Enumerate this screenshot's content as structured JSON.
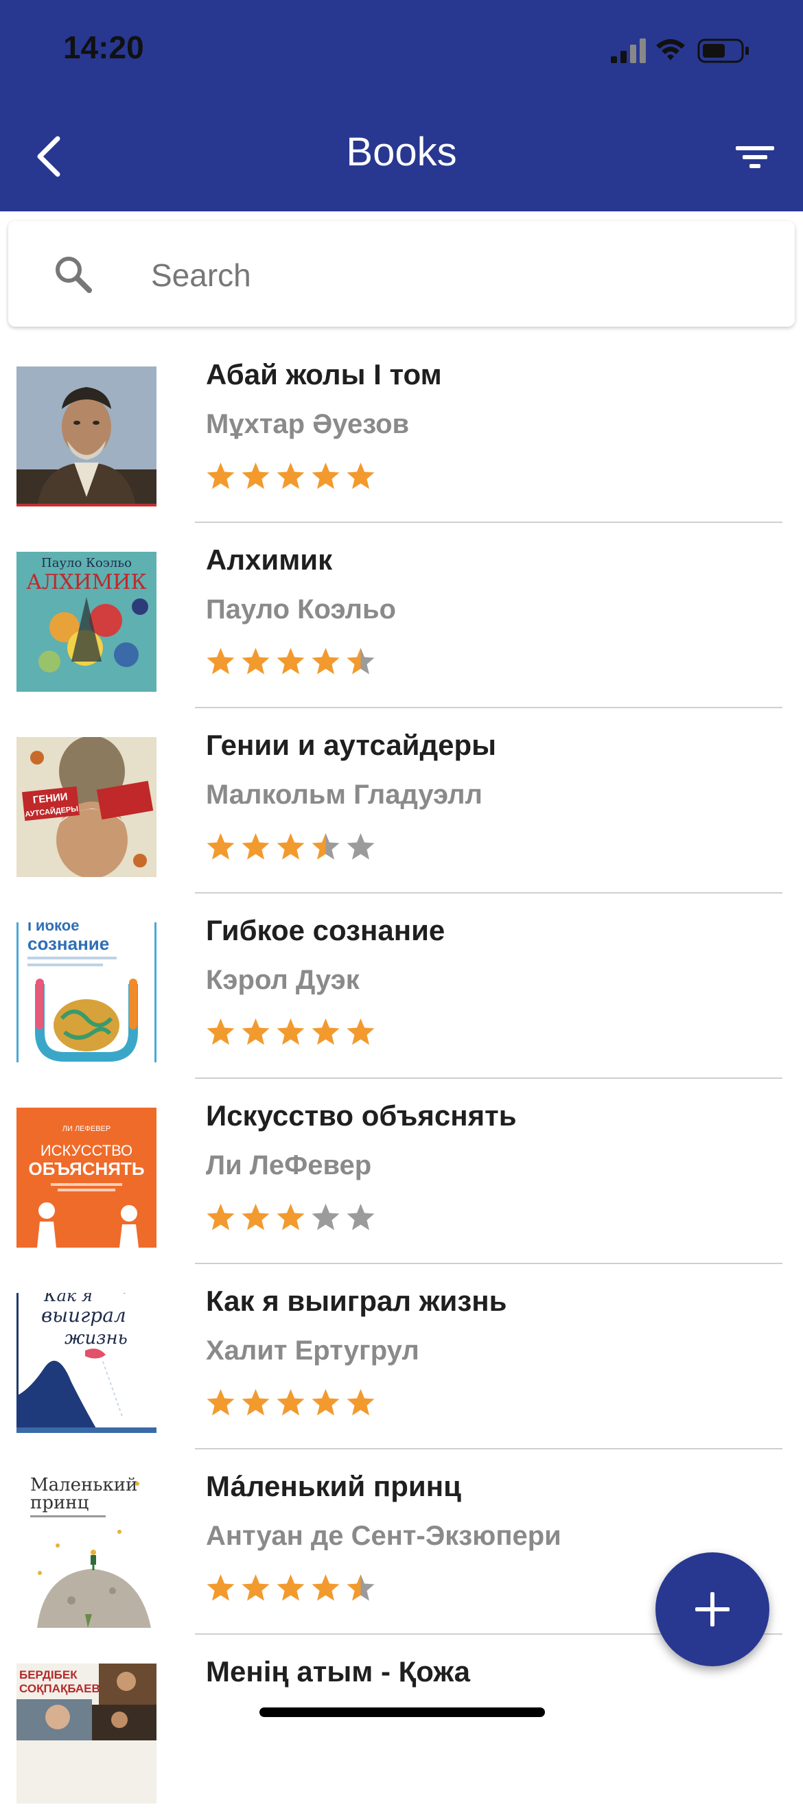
{
  "status_bar": {
    "time": "14:20"
  },
  "nav": {
    "title": "Books",
    "back_icon": "chevron-left-icon",
    "filter_icon": "filter-icon"
  },
  "search": {
    "placeholder": "Search",
    "value": ""
  },
  "colors": {
    "primary": "#283891",
    "star_active": "#F29A2E",
    "star_inactive": "#9B9B9B"
  },
  "books": [
    {
      "title": "Абай жолы I том",
      "author": "Мұхтар Әуезов",
      "rating": 5
    },
    {
      "title": "Алхимик",
      "author": "Пауло Коэльо",
      "rating": 4.5,
      "cover_text": [
        "Пауло Коэльо",
        "АЛХИМИК"
      ]
    },
    {
      "title": "Гении и аутсайдеры",
      "author": "Малкольм Гладуэлл",
      "rating": 3.5,
      "cover_text": [
        "ГЕНИИ",
        "АУТСАЙДЕРЫ"
      ]
    },
    {
      "title": "Гибкое сознание",
      "author": "Кэрол Дуэк",
      "rating": 5,
      "cover_text": [
        "Гибкое",
        "сознание"
      ]
    },
    {
      "title": "Искусство объяснять",
      "author": "Ли ЛеФевер",
      "rating": 3,
      "cover_text": [
        "ЛИ ЛЕФЕВЕР",
        "ИСКУССТВО",
        "ОБЪЯСНЯТЬ"
      ]
    },
    {
      "title": "Как я выиграл жизнь",
      "author": "Халит Ертугрул",
      "rating": 5,
      "cover_text": [
        "Как я",
        "выиграл",
        "жизнь"
      ]
    },
    {
      "title": "Ма́ленький принц",
      "author": "Антуан де Сент-Экзюпери",
      "rating": 4.5,
      "cover_text": [
        "Маленький",
        "принц"
      ]
    },
    {
      "title": "Менің атым - Қожа",
      "author": "",
      "rating": 0,
      "cover_text": [
        "БЕРДІБЕК",
        "СОҚПАҚБАЕВ"
      ]
    }
  ],
  "fab": {
    "icon": "plus-icon"
  }
}
